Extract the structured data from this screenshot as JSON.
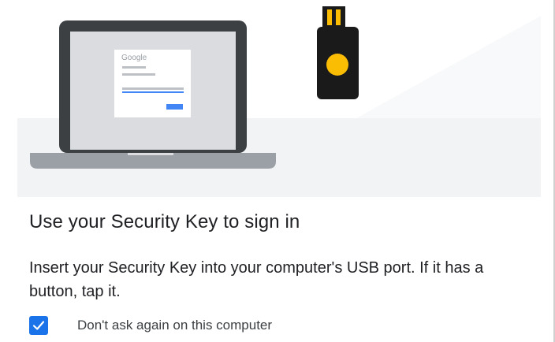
{
  "illustration": {
    "screen_logo_text": "Google"
  },
  "dialog": {
    "title": "Use your Security Key to sign in",
    "instructions": "Insert your Security Key into your computer's USB port. If it has a button, tap it.",
    "remember_checkbox": {
      "label": "Don't ask again on this computer",
      "checked": true
    }
  },
  "colors": {
    "checkbox_accent": "#1a73e8",
    "security_key_body": "#1a1a1a",
    "security_key_button": "#fbbc04",
    "laptop_frame": "#3c4043",
    "laptop_base": "#9aa0a6",
    "screen_button": "#4285f4"
  },
  "icons": {
    "checkbox_check": "check-icon",
    "laptop": "laptop-icon",
    "security_key": "security-key-icon"
  }
}
